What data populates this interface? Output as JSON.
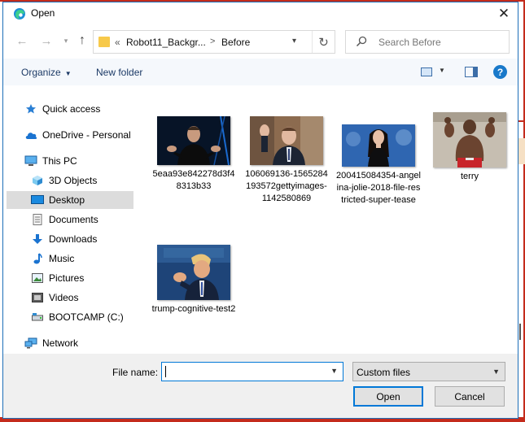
{
  "dialog": {
    "title": "Open",
    "close_symbol": "✕"
  },
  "nav": {
    "back_symbol": "←",
    "forward_symbol": "→",
    "up_symbol": "↑",
    "refresh_symbol": "↻",
    "breadcrumb_chevrons": "«",
    "breadcrumb_1": "Robot11_Backgr...",
    "breadcrumb_sep": ">",
    "breadcrumb_2": "Before",
    "search_placeholder": "Search Before"
  },
  "toolbar": {
    "organize_label": "Organize",
    "new_folder_label": "New folder",
    "help_symbol": "?"
  },
  "sidebar": {
    "items": [
      {
        "label": "Quick access",
        "icon": "star-icon"
      },
      {
        "label": "OneDrive - Personal",
        "icon": "cloud-icon"
      },
      {
        "label": "This PC",
        "icon": "computer-icon"
      },
      {
        "label": "3D Objects",
        "icon": "cube-icon"
      },
      {
        "label": "Desktop",
        "icon": "desktop-icon",
        "selected": true
      },
      {
        "label": "Documents",
        "icon": "document-icon"
      },
      {
        "label": "Downloads",
        "icon": "download-icon"
      },
      {
        "label": "Music",
        "icon": "music-icon"
      },
      {
        "label": "Pictures",
        "icon": "pictures-icon"
      },
      {
        "label": "Videos",
        "icon": "video-icon"
      },
      {
        "label": "BOOTCAMP (C:)",
        "icon": "drive-icon"
      },
      {
        "label": "Network",
        "icon": "network-icon"
      }
    ]
  },
  "files": [
    {
      "label": "5eaa93e842278d3f48313b33"
    },
    {
      "label": "106069136-1565284193572gettyimages-1142580869"
    },
    {
      "label": "200415084354-angelina-jolie-2018-file-restricted-super-tease"
    },
    {
      "label": "terry"
    },
    {
      "label": "trump-cognitive-test2"
    }
  ],
  "footer": {
    "filename_label": "File name:",
    "filename_value": "",
    "filetype_value": "Custom files",
    "open_label": "Open",
    "cancel_label": "Cancel"
  },
  "colors": {
    "accent": "#0078d7",
    "background_app_red": "#c42b1c"
  }
}
